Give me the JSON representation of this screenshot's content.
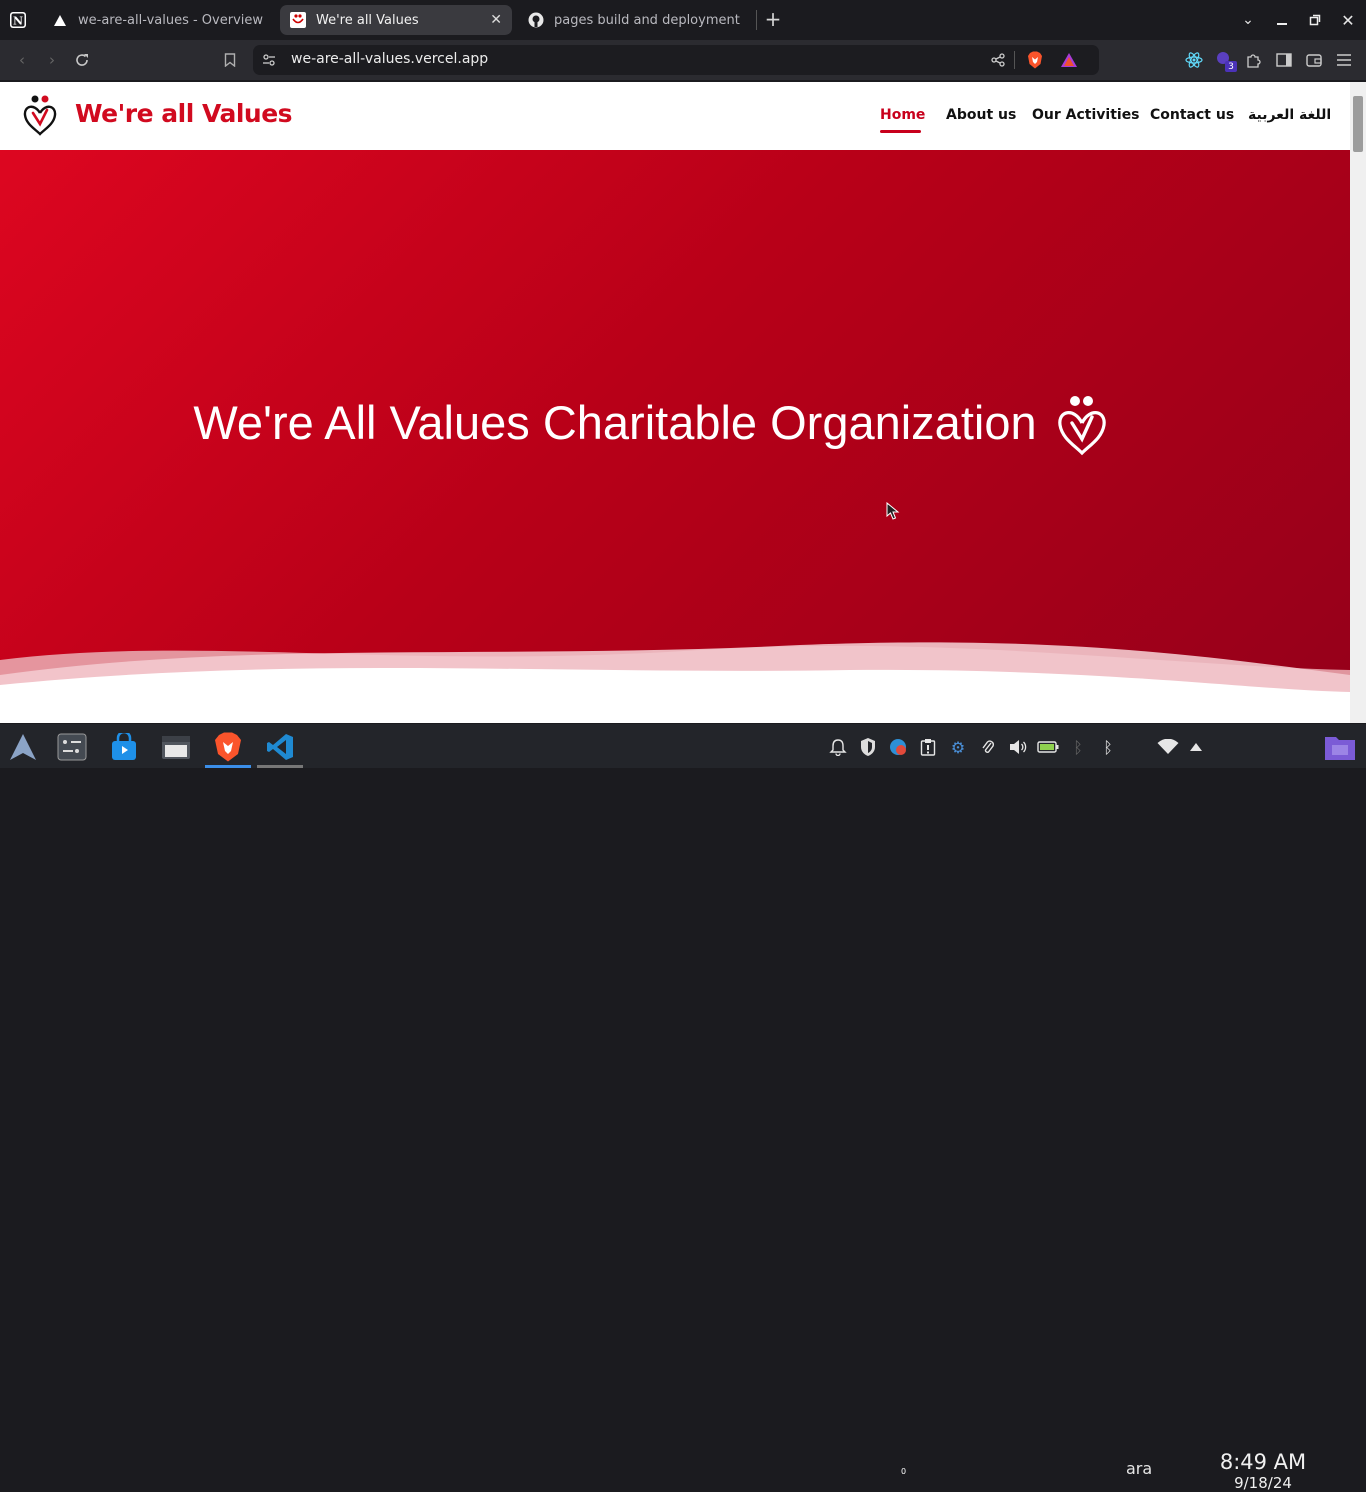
{
  "browser": {
    "tabs": [
      {
        "title": "we-are-all-values - Overview – V",
        "icon": "vercel-triangle-icon"
      },
      {
        "title": "We're all Values",
        "icon": "site-logo-icon",
        "active": true
      },
      {
        "title": "pages build and deployment · N",
        "icon": "github-icon"
      }
    ],
    "url": "we-are-all-values.vercel.app",
    "extension_badge": "3"
  },
  "site": {
    "brand": "We're all Values",
    "nav": [
      {
        "label": "Home",
        "active": true
      },
      {
        "label": "About us"
      },
      {
        "label": "Our Activities"
      },
      {
        "label": "Contact us"
      },
      {
        "label": "اللغة العربية"
      }
    ],
    "hero_title": "We're All Values Charitable Organization",
    "colors": {
      "primary": "#d10a1f",
      "hero_start": "#dd0620",
      "hero_end": "#95001a"
    }
  },
  "taskbar": {
    "keyboard_layout": "ara",
    "time": "8:49 AM",
    "date": "9/18/24",
    "apps": [
      "arch-linux-icon",
      "terminal-icon",
      "store-icon",
      "file-manager-icon",
      "brave-browser-icon",
      "vscode-icon"
    ],
    "notification_badge": "0"
  }
}
